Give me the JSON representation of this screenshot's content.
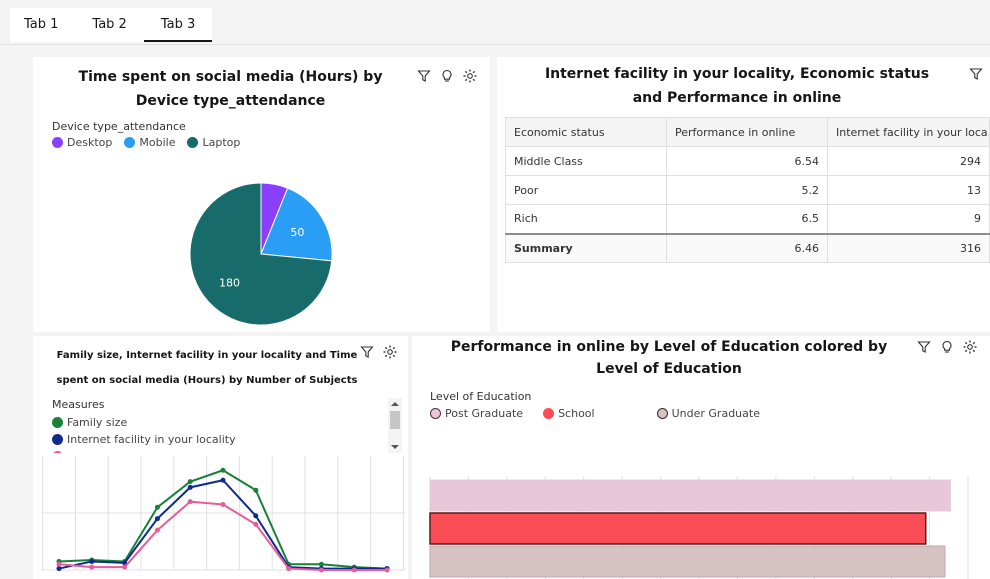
{
  "tabs": [
    "Tab 1",
    "Tab 2",
    "Tab 3"
  ],
  "active_tab": 2,
  "colors": {
    "desktop": "#8a3ffc",
    "mobile": "#2a9df4",
    "laptop": "#176b6b",
    "family_size": "#198038",
    "internet_facility": "#0f2a8f",
    "time_spent": "#e85c9a",
    "post_graduate": "#e8c8d8",
    "school": "#fa4d56",
    "under_graduate": "#d6c2c2"
  },
  "pie_card": {
    "title": "Time spent on social media (Hours) by Device type_attendance",
    "legend_title": "Device type_attendance",
    "icons": [
      "filter-icon",
      "lightbulb-icon",
      "settings-icon"
    ]
  },
  "table_card": {
    "title": "Internet facility in your locality, Economic status and Performance in online",
    "columns": [
      "Economic status",
      "Performance in online",
      "Internet facility in your loca..."
    ],
    "rows": [
      [
        "Middle Class",
        "6.54",
        "294"
      ],
      [
        "Poor",
        "5.2",
        "13"
      ],
      [
        "Rich",
        "6.5",
        "9"
      ]
    ],
    "summary": [
      "Summary",
      "6.46",
      "316"
    ]
  },
  "line_card": {
    "title": "Family size, Internet facility in your locality and Time spent on social media (Hours) by Number of Subjects",
    "legend_title": "Measures",
    "legend_items": [
      "Family size",
      "Internet facility in your locality"
    ]
  },
  "bar_card": {
    "title": "Performance in online by Level of Education colored by Level of Education",
    "legend_title": "Level of Education"
  },
  "chart_data": [
    {
      "type": "pie",
      "categories": [
        "Desktop",
        "Mobile",
        "Laptop"
      ],
      "values": [
        15,
        50,
        180
      ],
      "data_labels": [
        "",
        "50",
        "180"
      ]
    },
    {
      "type": "line",
      "x": [
        1,
        2,
        3,
        4,
        5,
        6,
        7,
        8,
        9,
        10,
        11
      ],
      "series": [
        {
          "name": "Family size",
          "values": [
            0.6,
            0.7,
            0.6,
            4.4,
            6.2,
            7.0,
            5.6,
            0.4,
            0.4,
            0.2,
            0.1
          ]
        },
        {
          "name": "Internet facility in your locality",
          "values": [
            0.1,
            0.6,
            0.5,
            3.6,
            5.8,
            6.3,
            3.8,
            0.2,
            0.1,
            0.1,
            0.1
          ]
        },
        {
          "name": "Time spent on social media (Hours)",
          "values": [
            0.4,
            0.2,
            0.2,
            2.8,
            4.8,
            4.6,
            3.2,
            0.1,
            0.0,
            0.0,
            0.0
          ]
        }
      ],
      "ylim": [
        0,
        8
      ]
    },
    {
      "type": "bar",
      "orientation": "horizontal",
      "categories": [
        "Post Graduate",
        "School",
        "Under Graduate"
      ],
      "values": [
        6.77,
        6.45,
        6.7
      ],
      "xlim": [
        0,
        7
      ],
      "ticks": [
        "0",
        "0.5",
        "1",
        "1.5",
        "2",
        "2.5",
        "3",
        "3.5",
        "4",
        "4.5",
        "5",
        "5.5",
        "6",
        "6.5",
        "7"
      ]
    }
  ]
}
